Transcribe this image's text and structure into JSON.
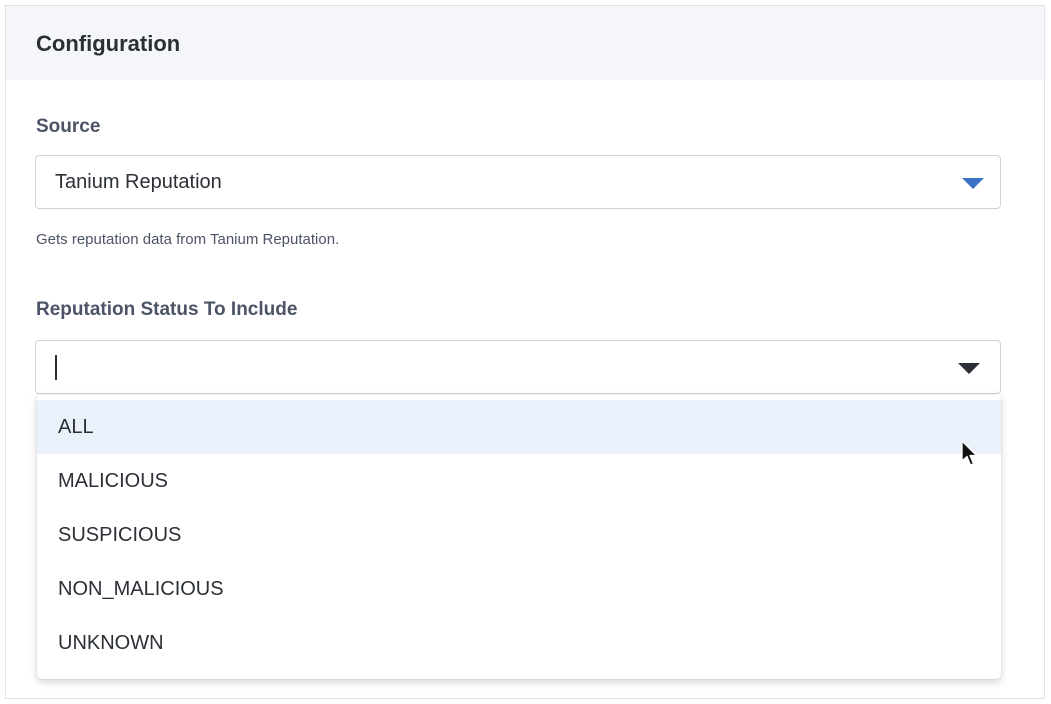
{
  "panel": {
    "title": "Configuration"
  },
  "source": {
    "label": "Source",
    "selected_value": "Tanium Reputation",
    "help_text": "Gets reputation data from Tanium Reputation.",
    "caret_color": "#3b73c9"
  },
  "reputation_status": {
    "label": "Reputation Status To Include",
    "input_value": "",
    "options": [
      {
        "label": "ALL",
        "hovered": true
      },
      {
        "label": "MALICIOUS",
        "hovered": false
      },
      {
        "label": "SUSPICIOUS",
        "hovered": false
      },
      {
        "label": "NON_MALICIOUS",
        "hovered": false
      },
      {
        "label": "UNKNOWN",
        "hovered": false
      }
    ]
  },
  "colors": {
    "header_bg": "#f4f6f9",
    "hover_bg": "#ebf1fa",
    "text": "#2b2f36",
    "label": "#4c5466"
  }
}
